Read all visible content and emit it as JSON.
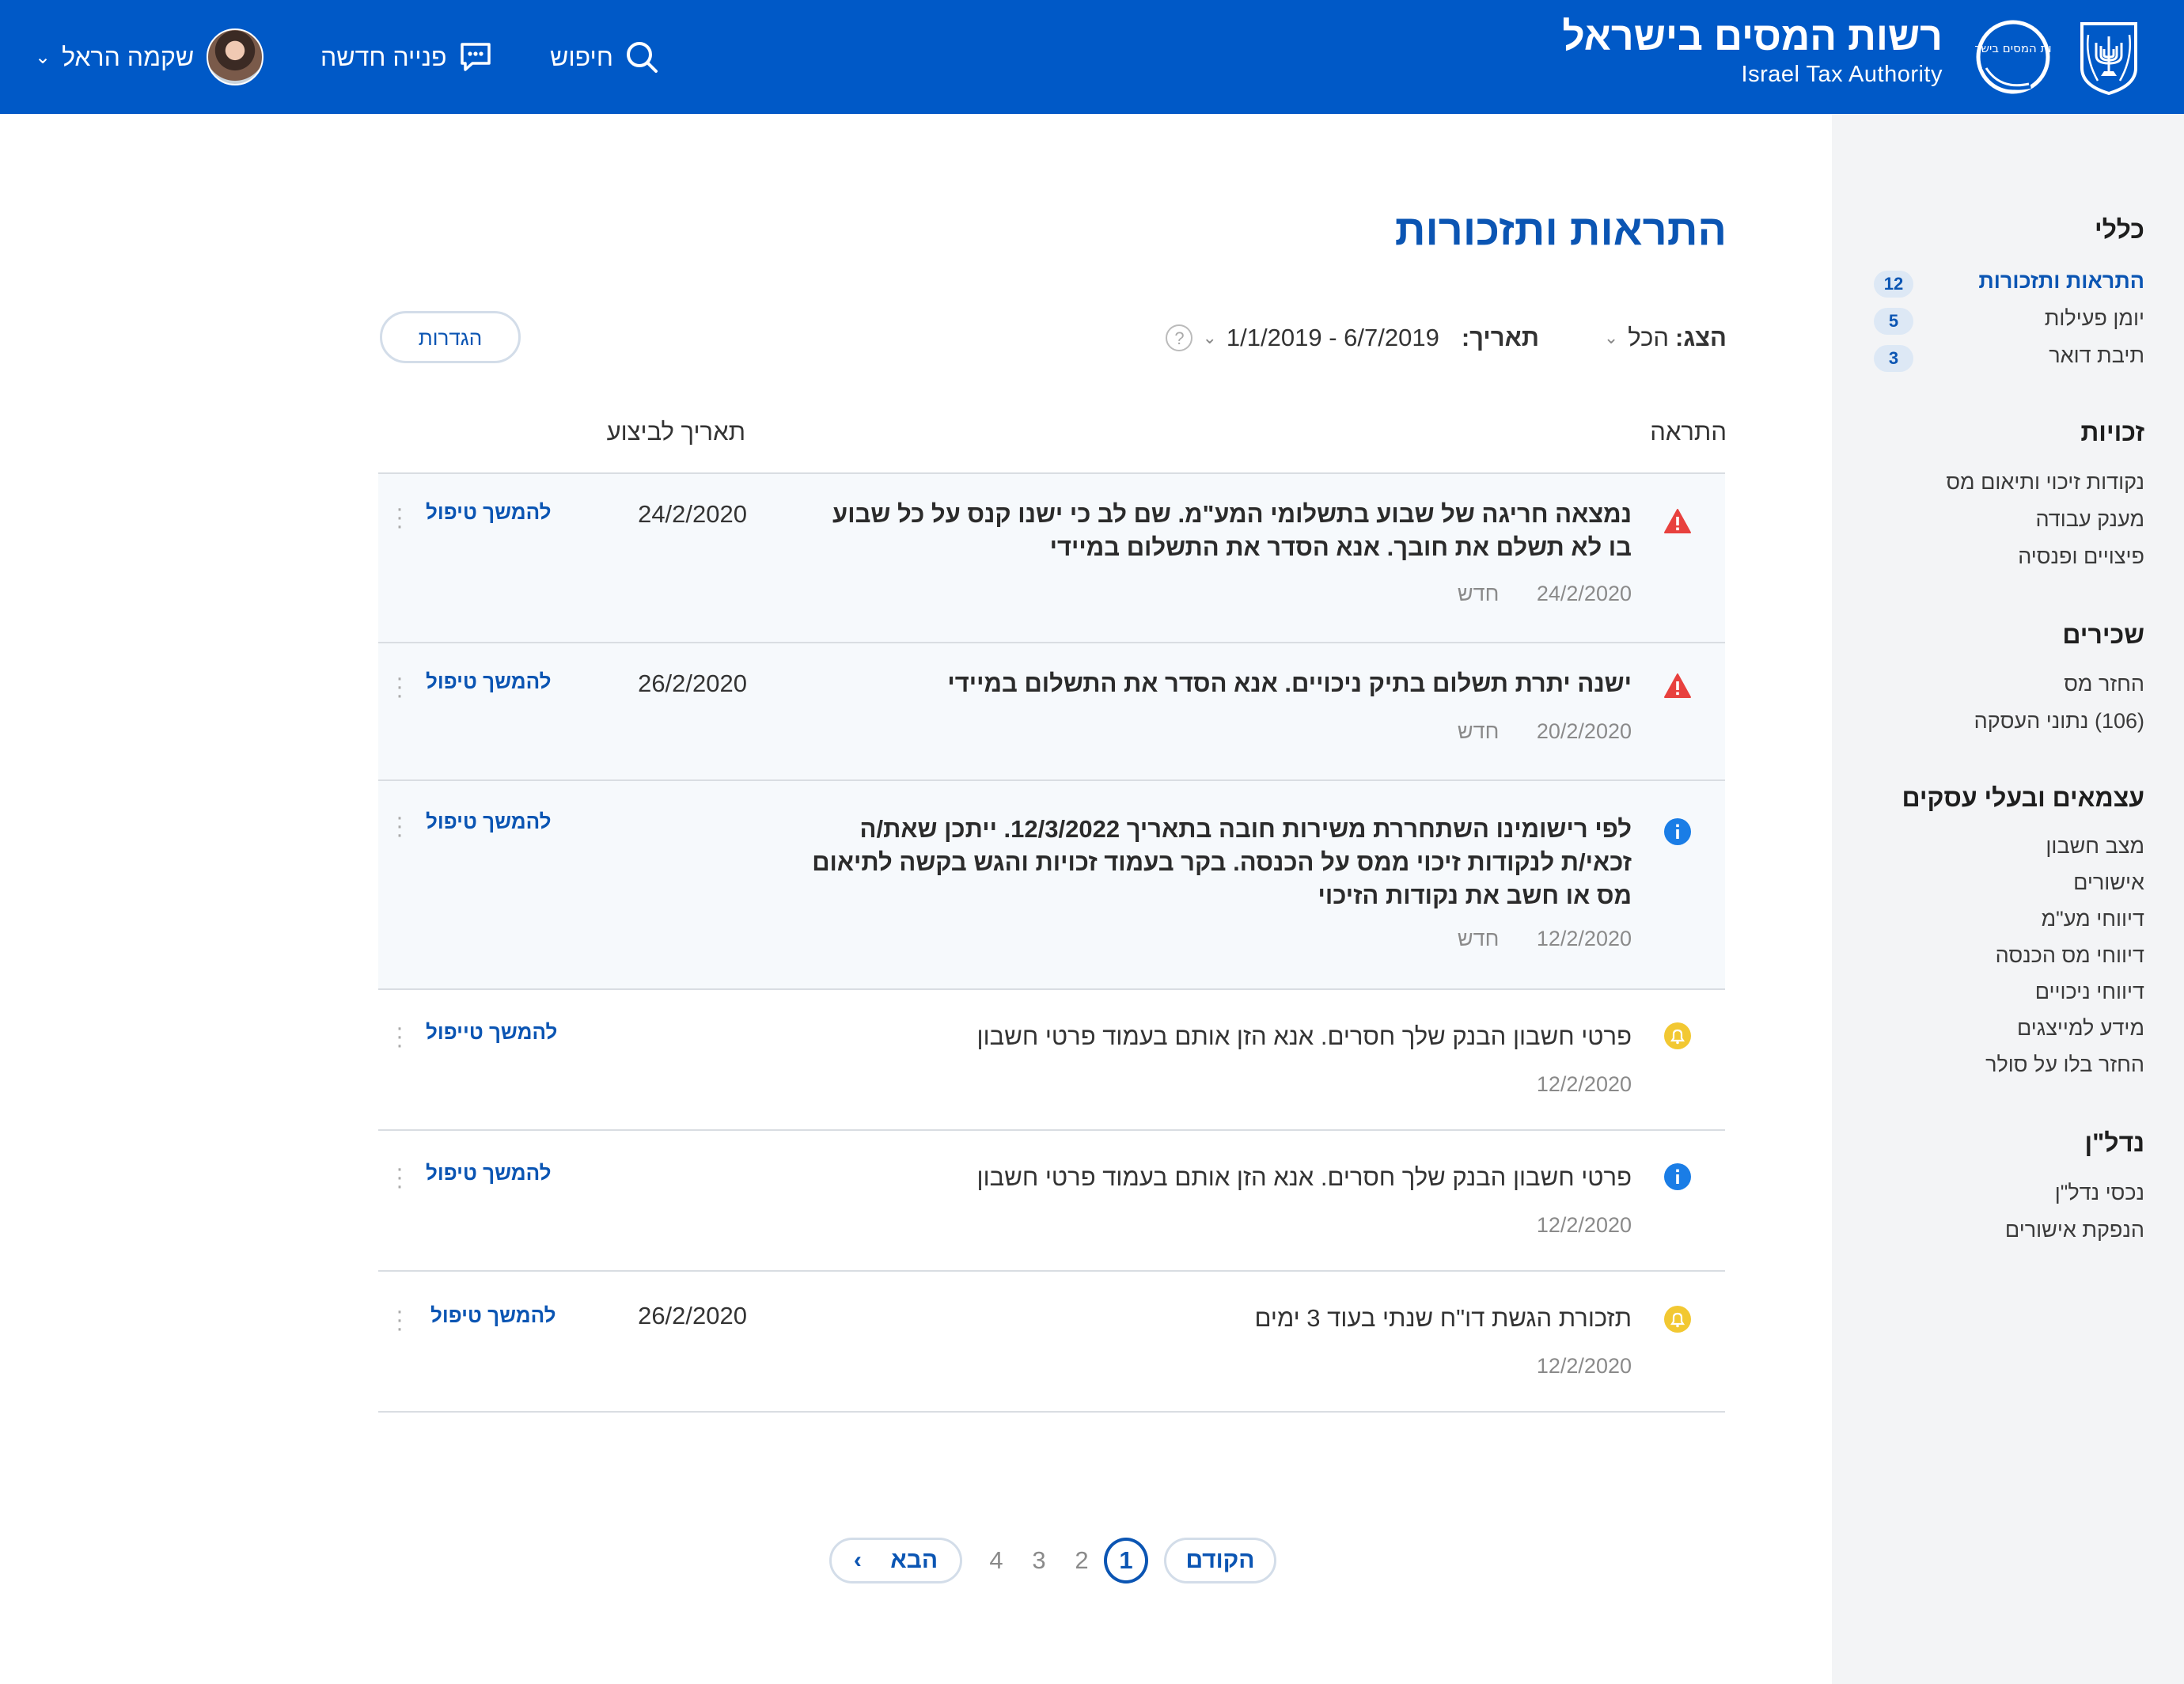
{
  "header": {
    "org_name_he": "רשות המסים בישראל",
    "org_name_en": "Israel Tax Authority",
    "logo_text": "רשות המסים בישראל",
    "search_label": "חיפוש",
    "new_request_label": "פנייה חדשה",
    "user_name": "שקמה הראל"
  },
  "sidebar": {
    "sections": [
      {
        "title": "כללי",
        "items": [
          {
            "label": "התראות ותזכורות",
            "badge": "12",
            "active": true
          },
          {
            "label": "יומן פעילות",
            "badge": "5"
          },
          {
            "label": "תיבת דואר",
            "badge": "3"
          }
        ]
      },
      {
        "title": "זכויות",
        "items": [
          {
            "label": "נקודות זיכוי ותיאום מס"
          },
          {
            "label": "מענק עבודה"
          },
          {
            "label": "פיצויים ופנסיה"
          }
        ]
      },
      {
        "title": "שכירים",
        "items": [
          {
            "label": "החזר מס"
          },
          {
            "label": "(106) נתוני העסקה"
          }
        ]
      },
      {
        "title": "עצמאים ובעלי עסקים",
        "items": [
          {
            "label": "מצב חשבון"
          },
          {
            "label": "אישורים"
          },
          {
            "label": "דיווחי מע\"מ"
          },
          {
            "label": "דיווחי מס הכנסה"
          },
          {
            "label": "דיווחי ניכויים"
          },
          {
            "label": "מידע למייצגים"
          },
          {
            "label": "החזר בלו על סולר"
          }
        ]
      },
      {
        "title": "נדל\"ן",
        "items": [
          {
            "label": "נכסי נדל\"ן"
          },
          {
            "label": "הנפקת אישורים"
          }
        ]
      }
    ]
  },
  "main": {
    "title": "התראות ותזכורות",
    "filters": {
      "show_label": "הצג:",
      "show_value": "הכל",
      "date_label": "תאריך:",
      "date_value": "6/7/2019 - 1/1/2019",
      "help": "?"
    },
    "settings_label": "הגדרות",
    "columns": {
      "alert": "התראה",
      "due": "תאריך לביצוע"
    },
    "rows": [
      {
        "icon": "warning-icon",
        "severity": "danger",
        "message": "נמצאה חריגה של שבוע בתשלומי המע\"מ. שם לב כי ישנו קנס על כל שבוע בו לא תשלם את חובך. אנא הסדר את התשלום במיידי",
        "date": "24/2/2020",
        "tag": "חדש",
        "due": "24/2/2020",
        "action": "להמשך טיפול"
      },
      {
        "icon": "warning-icon",
        "severity": "danger",
        "message": "ישנה יתרת תשלום בתיק ניכויים. אנא הסדר את התשלום במיידי",
        "date": "20/2/2020",
        "tag": "חדש",
        "due": "26/2/2020",
        "action": "להמשך טיפול"
      },
      {
        "icon": "info-icon",
        "severity": "info",
        "message": "לפי רישומינו השתחררת משירות חובה בתאריך 12/3/2022. ייתכן שאת/ה זכאי/ת לנקודות זיכוי ממס על הכנסה. בקר בעמוד זכויות והגש בקשה לתיאום מס או חשב את נקודות הזיכוי",
        "date": "12/2/2020",
        "tag": "חדש",
        "due": "",
        "action": "להמשך טיפול"
      },
      {
        "icon": "bell-icon",
        "severity": "reminder",
        "message": "פרטי חשבון הבנק שלך חסרים. אנא הזן אותם בעמוד פרטי חשבון",
        "date": "12/2/2020",
        "tag": "",
        "due": "",
        "action": "להמשך טייפול"
      },
      {
        "icon": "info-icon",
        "severity": "info",
        "message": "פרטי חשבון הבנק שלך חסרים. אנא הזן אותם בעמוד פרטי חשבון",
        "date": "12/2/2020",
        "tag": "",
        "due": "",
        "action": "להמשך טיפול"
      },
      {
        "icon": "bell-icon",
        "severity": "reminder",
        "message": "תזכורת הגשת דו\"ח שנתי בעוד 3 ימים",
        "date": "12/2/2020",
        "tag": "",
        "due": "26/2/2020",
        "action": "להמשך טיפול"
      }
    ]
  },
  "pagination": {
    "prev": "הקודם",
    "next": "הבא",
    "pages": [
      "1",
      "2",
      "3",
      "4"
    ],
    "current": "1"
  },
  "colors": {
    "header_bg": "#0059c7",
    "accent": "#0b55b3",
    "danger": "#e8413e",
    "info": "#1a7de6",
    "reminder": "#f2c832",
    "sidebar_bg": "#f3f4f6",
    "highlight_row": "#f6f9fc"
  }
}
